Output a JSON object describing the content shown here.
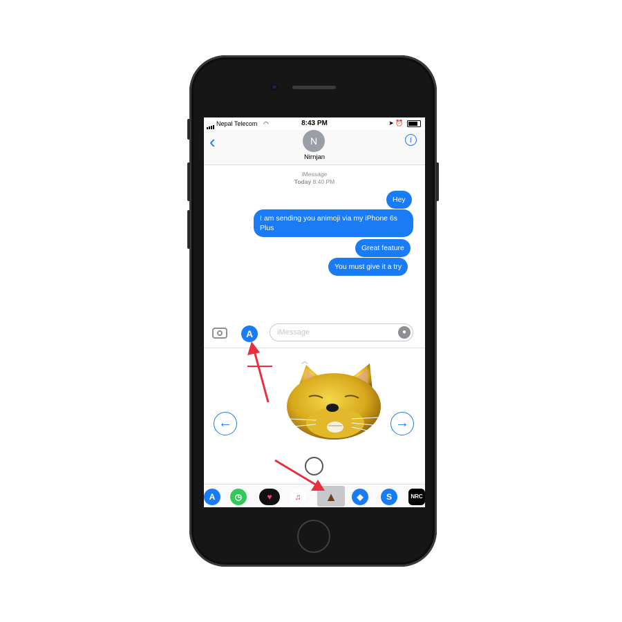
{
  "status_bar": {
    "carrier": "Nepal Telecom",
    "time": "8:43 PM"
  },
  "nav": {
    "back_icon": "chevron-left-icon",
    "avatar_initial": "N",
    "contact_name": "Nirnjan",
    "info_icon": "info-icon"
  },
  "conversation": {
    "service": "iMessage",
    "timestamp_day": "Today",
    "timestamp_time": "8:40 PM",
    "messages": [
      {
        "text": "Hey"
      },
      {
        "text": "I am sending you animoji via my iPhone 6s Plus"
      },
      {
        "text": "Great feature"
      },
      {
        "text": "You must give it a try"
      }
    ]
  },
  "composer": {
    "placeholder": "iMessage",
    "camera_icon": "camera-icon",
    "app_store_icon": "app-store-icon",
    "mic_icon": "microphone-icon"
  },
  "animoji_panel": {
    "selected_animoji": "cat",
    "prev_icon": "arrow-left-icon",
    "next_icon": "arrow-right-icon",
    "record_icon": "record-icon"
  },
  "app_tray": {
    "apps": [
      {
        "name": "app-store",
        "color": "#1a7cf5"
      },
      {
        "name": "clock",
        "color": "#34c759"
      },
      {
        "name": "digital-touch",
        "color": "#111111"
      },
      {
        "name": "music",
        "color": "#ffffff"
      },
      {
        "name": "animoji",
        "color": "#c8c8cc"
      },
      {
        "name": "drop",
        "color": "#1a7cf5"
      },
      {
        "name": "shazam",
        "color": "#1a7cf5"
      },
      {
        "name": "nrc",
        "color": "#000000",
        "label": "NRC"
      }
    ]
  },
  "colors": {
    "accent": "#1a7cf5",
    "annotation_arrow": "#e8303d"
  }
}
